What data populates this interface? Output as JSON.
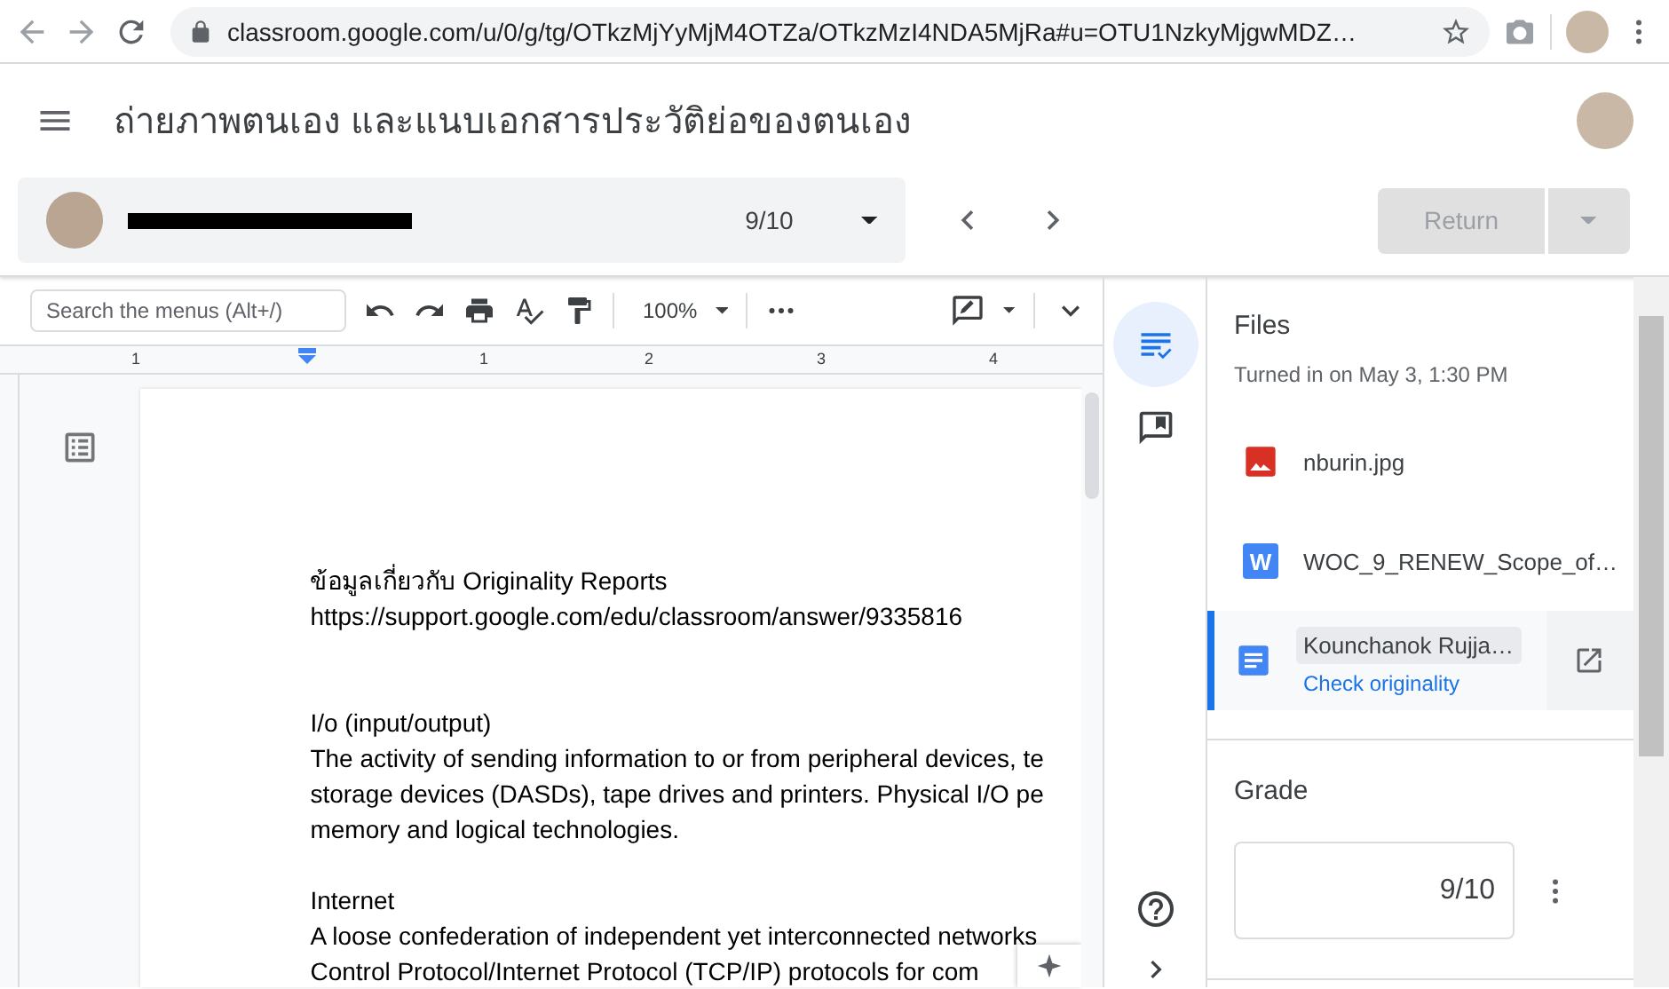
{
  "browser": {
    "url": "classroom.google.com/u/0/g/tg/OTkzMjYyMjM4OTZa/OTkzMzI4NDA5MjRa#u=OTU1NzkyMjgwMDZ…"
  },
  "header": {
    "title": "ถ่ายภาพตนเอง และแนบเอกสารประวัติย่อของตนเอง"
  },
  "student_bar": {
    "grade": "9/10"
  },
  "return_button": {
    "label": "Return",
    "disabled": true
  },
  "doc_toolbar": {
    "search_placeholder": "Search the menus (Alt+/)",
    "zoom": "100%"
  },
  "ruler": {
    "labels": [
      "1",
      "1",
      "2",
      "3",
      "4"
    ]
  },
  "document": {
    "blocks": [
      {
        "lines": [
          "ข้อมูลเกี่ยวกับ Originality Reports",
          "https://support.google.com/edu/classroom/answer/9335816"
        ]
      },
      {
        "lines": [
          "I/o (input/output)",
          "The activity of sending information to or from peripheral devices, te",
          "storage devices (DASDs), tape drives and printers. Physical I/O pe",
          "memory and logical technologies."
        ]
      },
      {
        "lines": [
          "Internet",
          "A loose confederation of independent yet interconnected networks",
          "Control Protocol/Internet Protocol (TCP/IP) protocols for com"
        ]
      }
    ]
  },
  "files_panel": {
    "title": "Files",
    "turned_in": "Turned in on May 3, 1:30 PM",
    "files": [
      {
        "kind": "image",
        "name": "nburin.jpg",
        "selected": false
      },
      {
        "kind": "word",
        "badge": "W",
        "name": "WOC_9_RENEW_Scope_of…",
        "selected": false
      },
      {
        "kind": "doc",
        "name": "Kounchanok Rujja…",
        "link": "Check originality",
        "selected": true
      }
    ]
  },
  "grade": {
    "label": "Grade",
    "value": "9/10"
  }
}
